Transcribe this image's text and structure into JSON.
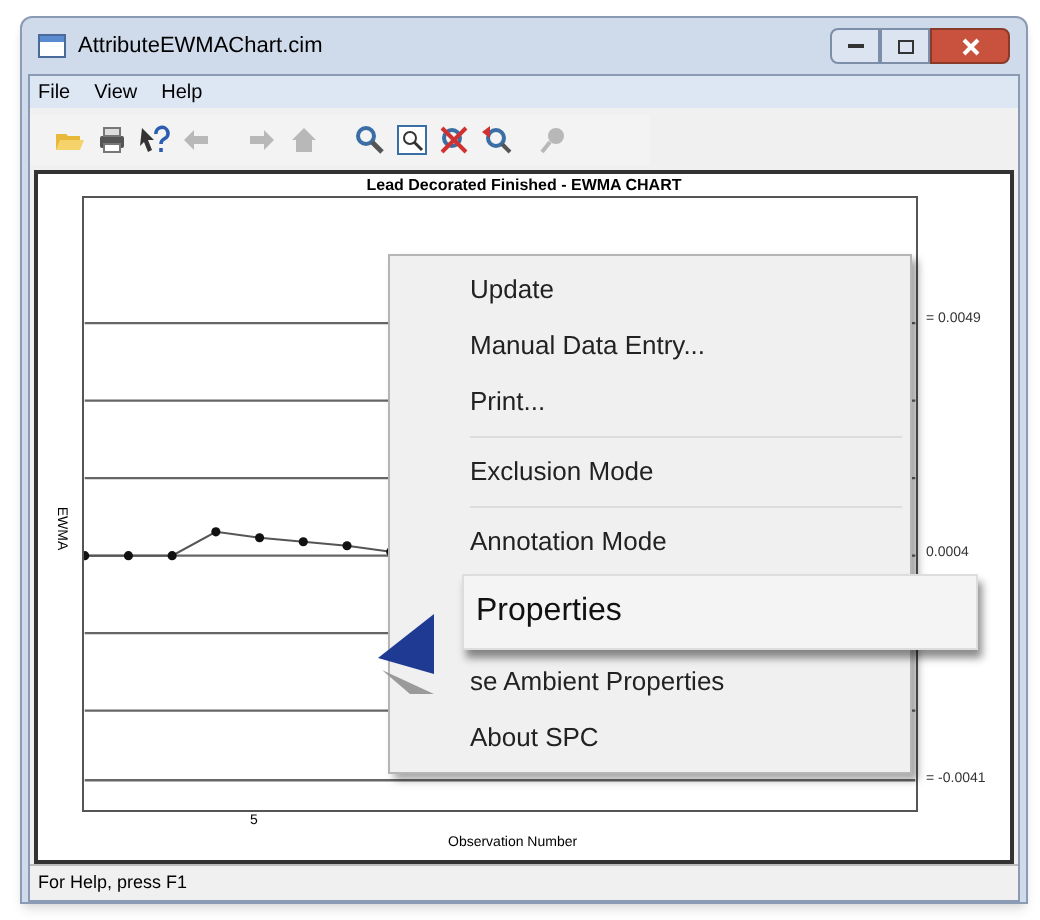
{
  "window": {
    "title": "AttributeEWMAChart.cim"
  },
  "menu": [
    "File",
    "View",
    "Help"
  ],
  "toolbar": [
    {
      "kind": "open",
      "disabled": false
    },
    {
      "kind": "print",
      "disabled": false
    },
    {
      "kind": "help",
      "disabled": false
    },
    {
      "kind": "back",
      "disabled": true
    },
    {
      "kind": "forward",
      "disabled": true
    },
    {
      "kind": "home",
      "disabled": true
    },
    {
      "kind": "zoom",
      "disabled": false
    },
    {
      "kind": "zoombox",
      "disabled": false
    },
    {
      "kind": "zoomcross",
      "disabled": false
    },
    {
      "kind": "zoomundo",
      "disabled": false
    },
    {
      "kind": "pin",
      "disabled": true
    }
  ],
  "chart": {
    "title": "Lead Decorated Finished - EWMA CHART",
    "ylabel": "EWMA",
    "xlabel": "Observation Number",
    "xtick": "5",
    "limits": [
      "= 0.0049",
      "0.0004",
      "= -0.0041"
    ]
  },
  "context_menu": {
    "items": [
      {
        "kind": "item",
        "label": "Update",
        "selected": false
      },
      {
        "kind": "item",
        "label": "Manual Data Entry...",
        "selected": false
      },
      {
        "kind": "item",
        "label": "Print...",
        "selected": false
      },
      {
        "kind": "separator"
      },
      {
        "kind": "item",
        "label": "Exclusion Mode",
        "selected": false
      },
      {
        "kind": "separator"
      },
      {
        "kind": "item",
        "label": "Annotation Mode",
        "selected": false
      },
      {
        "kind": "item",
        "label": "Properties",
        "selected": true
      },
      {
        "kind": "item",
        "label": "se Ambient Properties",
        "selected": false,
        "pointer": true
      },
      {
        "kind": "item",
        "label": "About SPC",
        "selected": false
      }
    ]
  },
  "status_bar": "For Help, press F1"
}
